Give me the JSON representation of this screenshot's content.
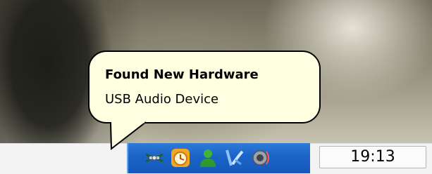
{
  "notification": {
    "title": "Found New Hardware",
    "message": "USB Audio Device"
  },
  "tray": {
    "icons": [
      "network-tools-icon",
      "clock-app-icon",
      "messenger-user-icon",
      "audio-device-icon",
      "volume-speaker-icon"
    ]
  },
  "clock": {
    "time": "19:13"
  },
  "colors": {
    "balloon_background": "#ffffe1",
    "tray_blue": "#1c64c8"
  }
}
